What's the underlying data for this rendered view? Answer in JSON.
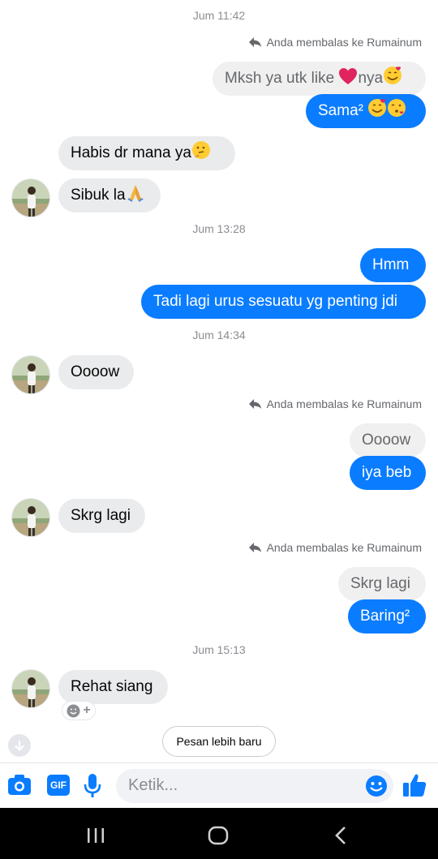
{
  "conversation": {
    "timestamps": [
      "Jum 11:42",
      "Jum 13:28",
      "Jum 14:34",
      "Jum 15:13"
    ],
    "reply_notice": "Anda membalas ke Rumainum",
    "messages": {
      "m1_quote": "Mksh ya utk like",
      "m1_quote_tail": "nya",
      "m2_out": "Sama²",
      "m3_in": "Habis dr mana  ya",
      "m4_in": "Sibuk la",
      "m5_out": "Hmm",
      "m6_out": "Tadi lagi urus sesuatu yg penting jdi",
      "m7_in": "Oooow",
      "m8_quote": "Oooow",
      "m9_out": "iya beb",
      "m10_in": "Skrg lagi",
      "m11_quote": "Skrg lagi",
      "m12_out": "Baring²",
      "m13_in": "Rehat siang"
    },
    "reaction_add": "+",
    "new_messages_label": "Pesan lebih baru"
  },
  "composer": {
    "placeholder": "Ketik...",
    "gif_label": "GIF",
    "icons": [
      "camera-icon",
      "gif-icon",
      "microphone-icon",
      "emoji-icon",
      "thumbs-up-icon"
    ]
  },
  "colors": {
    "accent": "#0a7cff",
    "incoming_bubble": "#eaebed",
    "quote_bubble": "#f0f0f0",
    "timestamp": "#8a8d91"
  }
}
